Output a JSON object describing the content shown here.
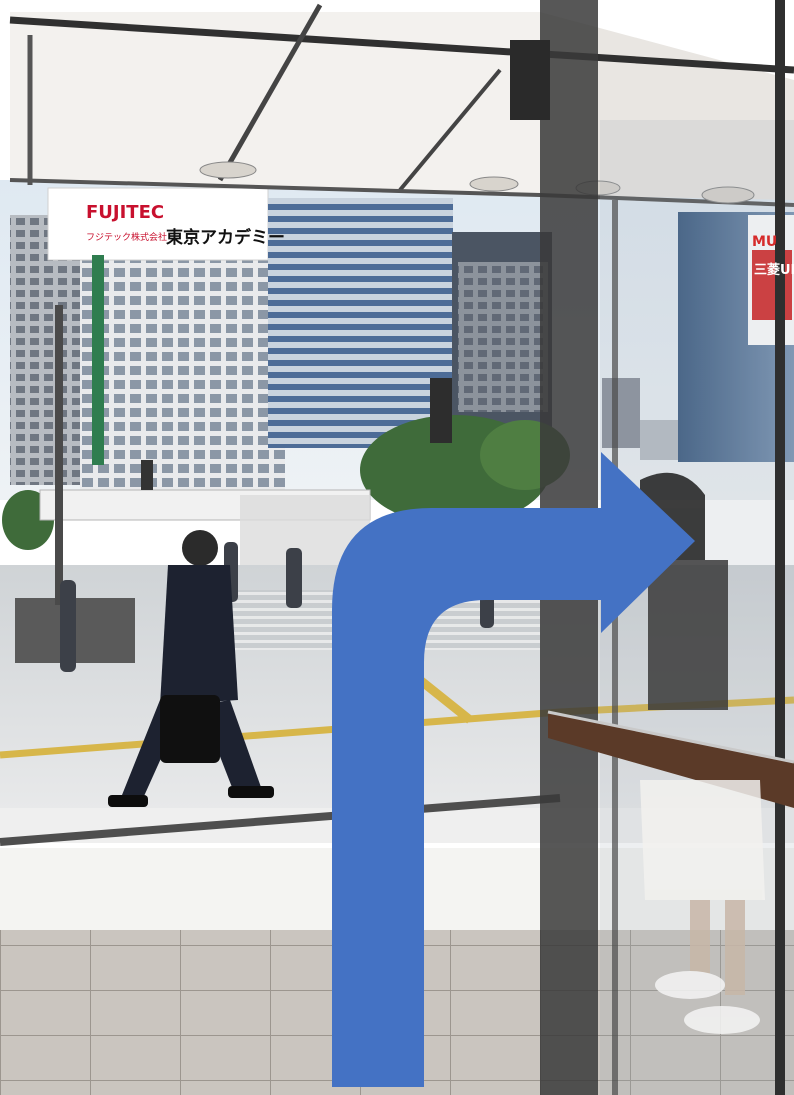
{
  "photo": {
    "signs": {
      "fujitec": "FUJITEC",
      "fujitec_sub": "フジテック株式会社",
      "academy": "東京アカデミー",
      "mufg_top": "MU",
      "mufg_bottom": "三菱UF"
    },
    "arrow": {
      "direction": "turn-right",
      "color": "#4472C4"
    }
  }
}
